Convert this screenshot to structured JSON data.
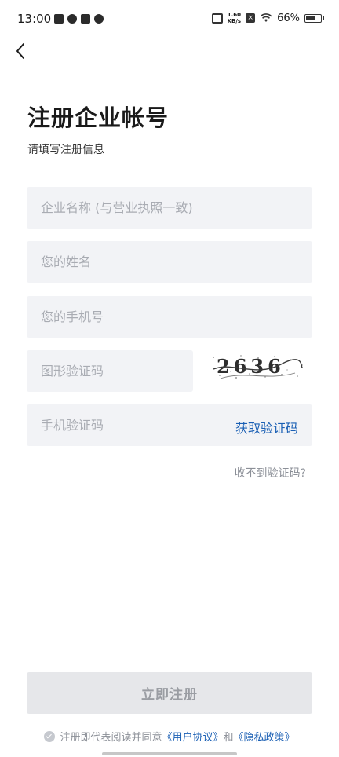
{
  "status_bar": {
    "time": "13:00",
    "net_speed_value": "1.60",
    "net_speed_unit": "KB/s",
    "battery_percent": "66%"
  },
  "header": {
    "title": "注册企业帐号",
    "subtitle": "请填写注册信息"
  },
  "form": {
    "company_placeholder": "企业名称 (与营业执照一致)",
    "name_placeholder": "您的姓名",
    "phone_placeholder": "您的手机号",
    "captcha_placeholder": "图形验证码",
    "captcha_text": "2636",
    "sms_placeholder": "手机验证码",
    "sms_button_label": "获取验证码",
    "no_code_link": "收不到验证码?",
    "submit_label": "立即注册"
  },
  "agreement": {
    "prefix": "注册即代表阅读并同意",
    "user_agreement": "《用户协议》",
    "conjunction": "和",
    "privacy_policy": "《隐私政策》"
  },
  "colors": {
    "accent": "#1a5fb4",
    "field_bg": "#f2f3f6",
    "button_disabled_bg": "#e6e7ea"
  }
}
